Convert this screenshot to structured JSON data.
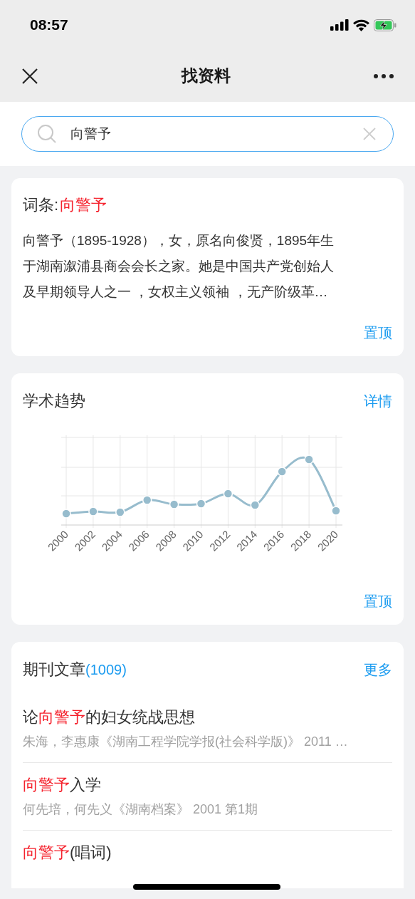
{
  "status_bar": {
    "time": "08:57",
    "battery_charging": true
  },
  "nav": {
    "title": "找资料"
  },
  "search": {
    "value": "向警予"
  },
  "entry_card": {
    "label": "词条:",
    "term": "向警予",
    "summary_lines": [
      "向警予（1895-1928），女，原名向俊贤，1895年生",
      "于湖南溆浦县商会会长之家。她是中国共产党创始人",
      "及早期领导人之一 ，女权主义领袖 ，无产阶级革…"
    ],
    "pin": "置顶"
  },
  "trend_card": {
    "title": "学术趋势",
    "details": "详情",
    "x_labels": [
      "2000",
      "2002",
      "2004",
      "2006",
      "2008",
      "2010",
      "2012",
      "2014",
      "2016",
      "2018",
      "2020"
    ],
    "pin": "置顶"
  },
  "articles_card": {
    "title": "期刊文章",
    "count": "(1009)",
    "more": "更多",
    "items": [
      {
        "title": [
          {
            "text": "论",
            "highlight": false
          },
          {
            "text": "向警予",
            "highlight": true
          },
          {
            "text": "的妇女统战思想",
            "highlight": false
          }
        ],
        "meta": "朱海，李惠康《湖南工程学院学报(社会科学版)》 2011 …"
      },
      {
        "title": [
          {
            "text": "向警予",
            "highlight": true
          },
          {
            "text": "入学",
            "highlight": false
          }
        ],
        "meta": "何先培，何先义《湖南档案》 2001 第1期"
      },
      {
        "title": [
          {
            "text": "向警予",
            "highlight": true
          },
          {
            "text": "(唱词)",
            "highlight": false
          }
        ]
      }
    ]
  }
}
